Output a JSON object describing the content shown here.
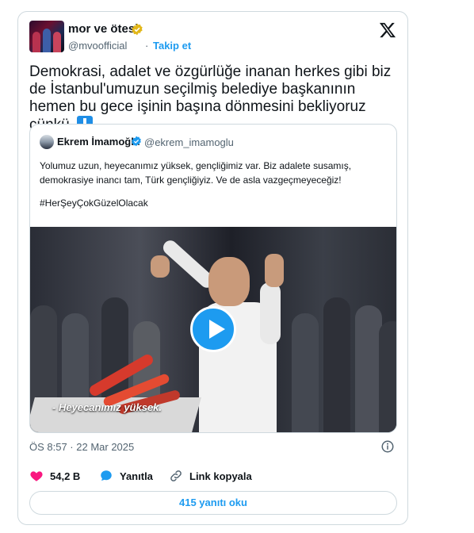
{
  "tweet": {
    "author_name": "mor ve ötesi",
    "handle": "@mvoofficial",
    "separator": "·",
    "follow_label": "Takip et",
    "text": "Demokrasi, adalet ve özgürlüğe inanan herkes gibi biz de İstanbul'umuzun seçilmiş belediye başkanının hemen bu gece işinin başına dönmesini bekliyoruz çünkü",
    "timestamp": "ÖS 8:57 · 22 Mar 2025"
  },
  "quoted_tweet": {
    "author_name": "Ekrem İmamoğlu",
    "handle": "@ekrem_imamoglu",
    "text": "Yolumuz uzun, heyecanımız yüksek, gençliğimiz var. Biz adalete susamış, demokrasiye inancı tam, Türk gençliğiyiz. Ve de asla vazgeçmeyeceğiz!",
    "hashtag": "#HerŞeyÇokGüzelOlacak",
    "video_subtitle": "- Heyecanımız yüksek."
  },
  "actions": {
    "likes": "54,2 B",
    "reply_label": "Yanıtla",
    "copy_link_label": "Link kopyala",
    "read_replies_label": "415 yanıtı oku"
  },
  "colors": {
    "accent": "#1d9bf0",
    "like": "#f91880",
    "verified": "#e2b719",
    "muted_text": "#536471"
  }
}
